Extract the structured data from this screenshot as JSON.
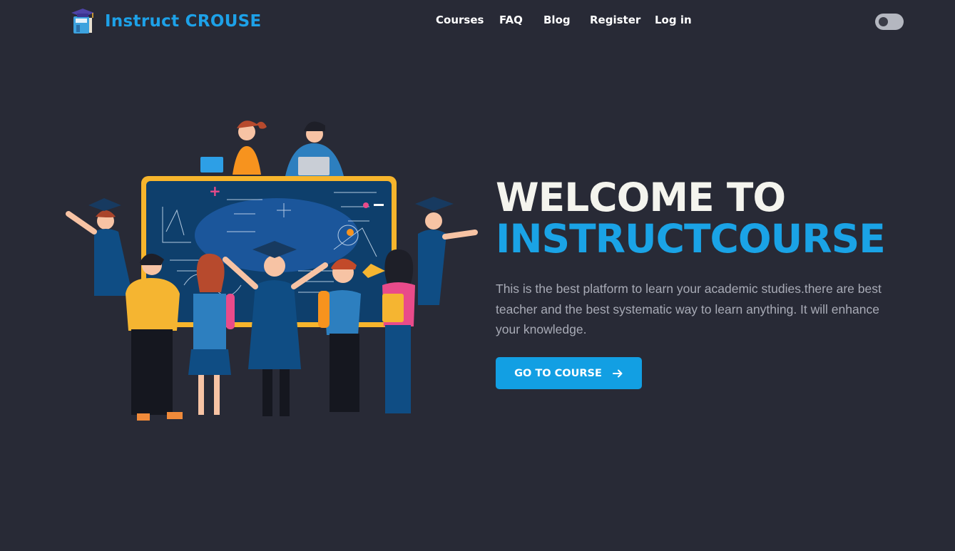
{
  "brand": {
    "name": "Instruct CROUSE",
    "logo_icon": "book-graduation-cap-icon"
  },
  "nav": {
    "courses": "Courses",
    "faq": "FAQ",
    "blog": "Blog",
    "register": "Register",
    "login": "Log in"
  },
  "theme_toggle": {
    "state": "off",
    "icon": "toggle-switch-icon"
  },
  "hero": {
    "title_line1": "WELCOME TO",
    "title_line2": "INSTRUCTCOURSE",
    "description": "This is the best platform to learn your academic studies.there are best teacher and the best systematic way to learn anything. It will enhance your knowledge.",
    "cta_label": "GO TO COURSE",
    "cta_icon": "arrow-right-icon",
    "illustration": "students-blackboard-illustration"
  },
  "colors": {
    "background": "#282a36",
    "accent": "#1aa3e6",
    "button": "#129fe3",
    "title_light": "#f4f4ee",
    "body_text": "#a8abb6"
  }
}
